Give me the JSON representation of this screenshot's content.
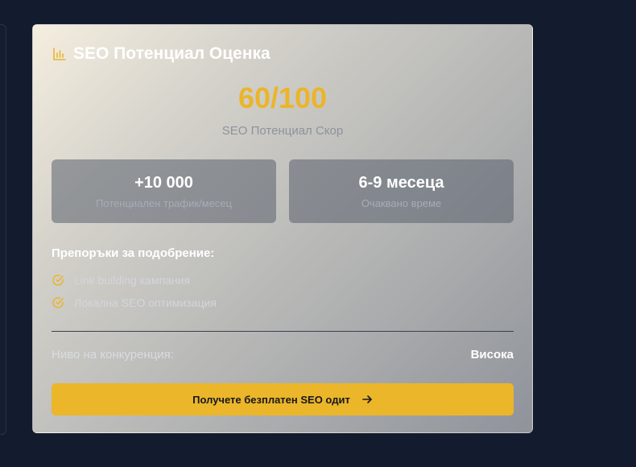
{
  "card": {
    "title": "SEO Потенциал Оценка",
    "title_icon": "bar-chart-icon",
    "score": "60/100",
    "score_label": "SEO Потенциал Скор"
  },
  "stats": [
    {
      "value": "+10 000",
      "label": "Потенциален трафик/месец"
    },
    {
      "value": "6-9 месеца",
      "label": "Очаквано време"
    }
  ],
  "recommendations": {
    "heading": "Препоръки за подобрение:",
    "items": [
      {
        "text": "Link building кампания",
        "icon": "check-circle-icon"
      },
      {
        "text": "Локална SEO оптимизация",
        "icon": "check-circle-icon"
      }
    ]
  },
  "competition": {
    "label": "Ниво на конкуренция:",
    "value": "Висока"
  },
  "cta": {
    "label": "Получете безплатен SEO одит",
    "icon": "arrow-right-icon"
  },
  "colors": {
    "background": "#131b2e",
    "accent": "#ecb62a"
  }
}
